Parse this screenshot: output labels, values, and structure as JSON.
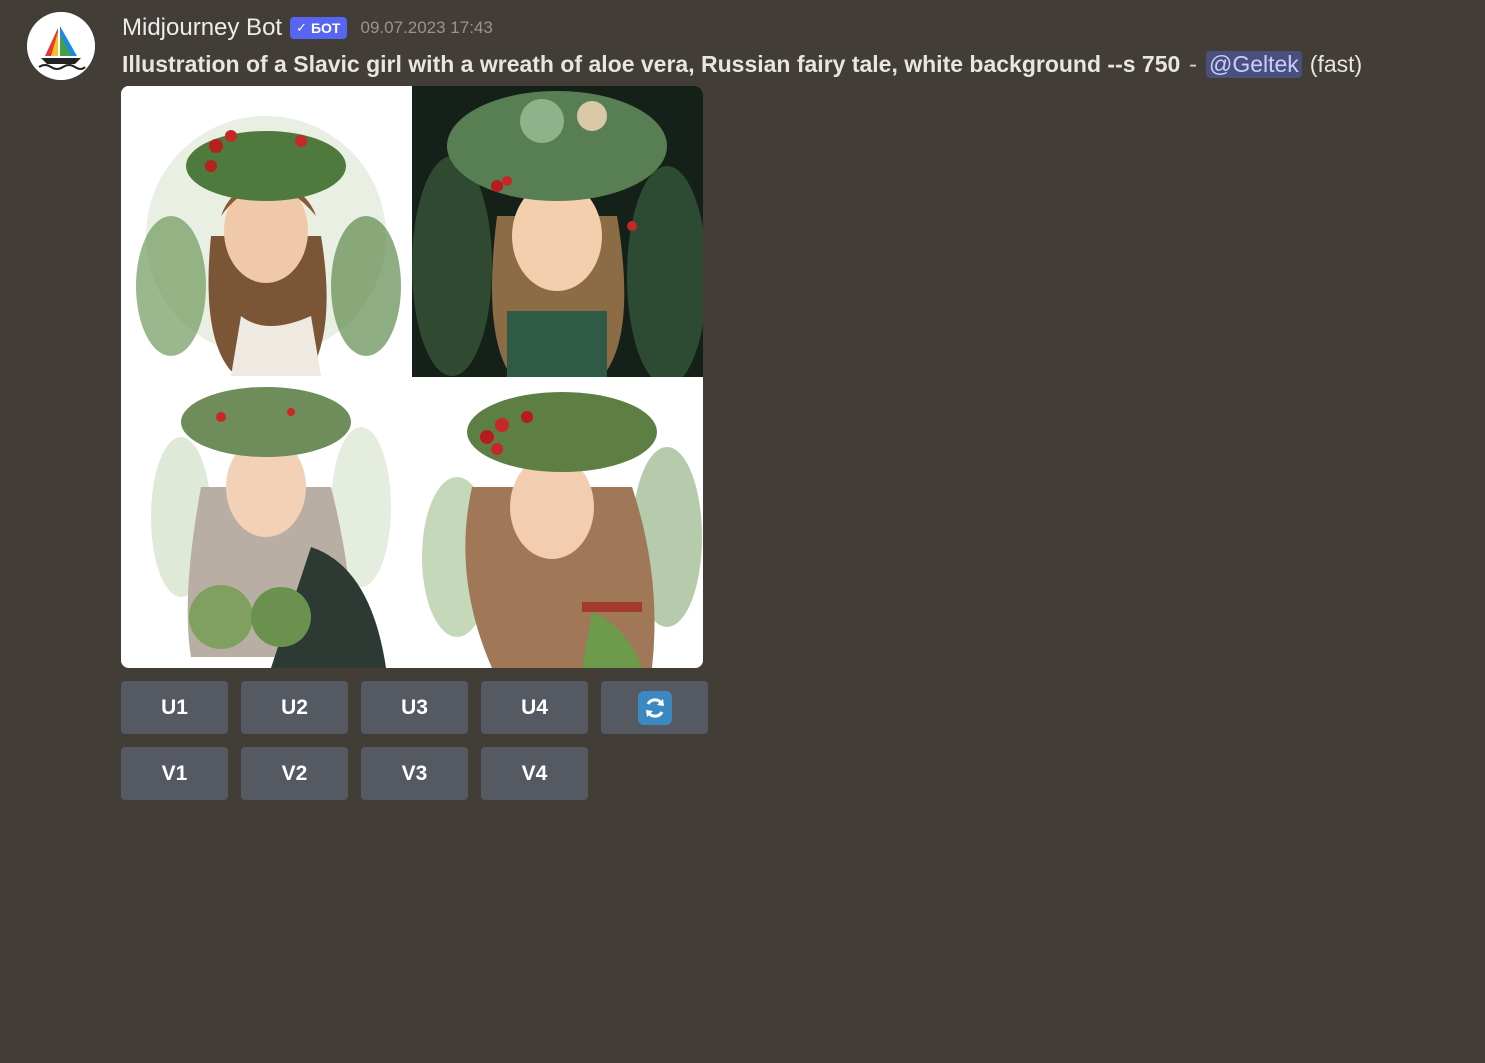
{
  "message": {
    "author": "Midjourney Bot",
    "badge": "БОТ",
    "timestamp": "09.07.2023 17:43",
    "prompt": "Illustration of a Slavic girl with a wreath of aloe vera, Russian fairy tale, white background --s 750",
    "separator": "-",
    "mention": "@Geltek",
    "speed": "(fast)"
  },
  "images": [
    {
      "name": "image-1"
    },
    {
      "name": "image-2"
    },
    {
      "name": "image-3"
    },
    {
      "name": "image-4"
    }
  ],
  "buttons": {
    "upscale": [
      "U1",
      "U2",
      "U3",
      "U4"
    ],
    "variation": [
      "V1",
      "V2",
      "V3",
      "V4"
    ],
    "reroll_icon": "refresh-icon"
  },
  "colors": {
    "background": "#423d36",
    "button": "#555a62",
    "bot_badge": "#5865f2",
    "mention_bg": "#4b4f7c",
    "reroll_icon": "#3b88c3"
  }
}
